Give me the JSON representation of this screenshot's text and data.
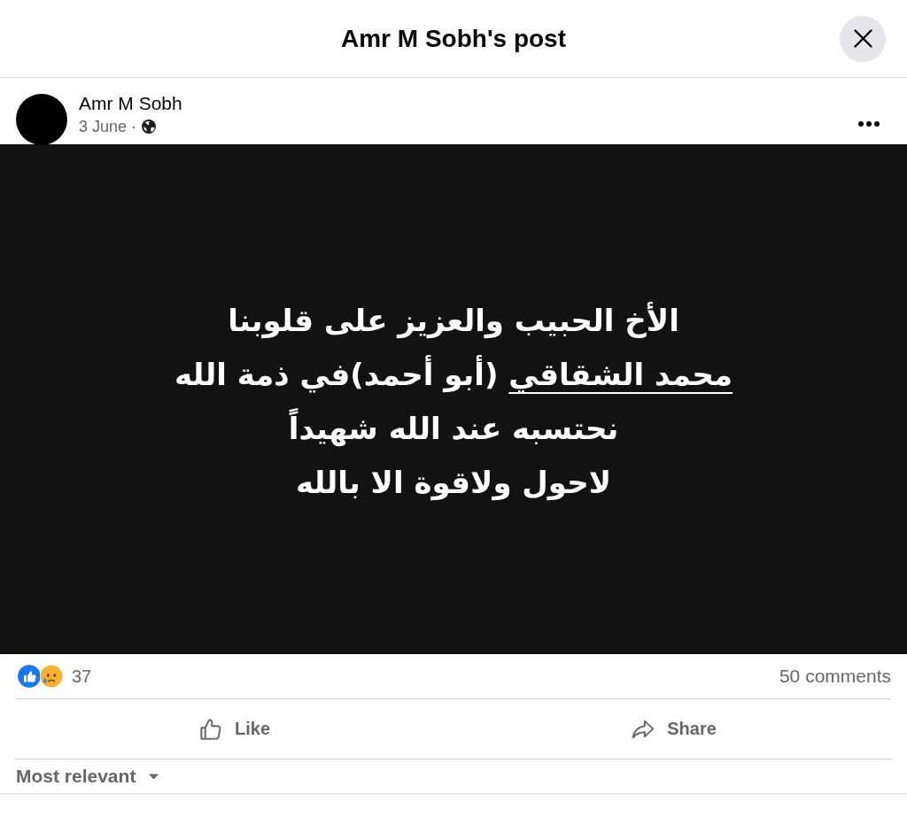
{
  "dialog": {
    "title": "Amr M Sobh's post"
  },
  "post": {
    "author": "Amr M Sobh",
    "date": "3 June ·",
    "text_lines": [
      {
        "segments": [
          {
            "kind": "plain",
            "text": "الأخ الحبيب والعزيز على قلوبنا"
          }
        ]
      },
      {
        "segments": [
          {
            "kind": "mention",
            "text": "محمد الشقاقي"
          },
          {
            "kind": "plain",
            "text": " (أبو أحمد)في ذمة الله"
          }
        ]
      },
      {
        "segments": [
          {
            "kind": "plain",
            "text": "نحتسبه عند الله شهيداً"
          }
        ]
      },
      {
        "segments": [
          {
            "kind": "plain",
            "text": "لاحول ولاقوة الا بالله"
          }
        ]
      }
    ]
  },
  "reactions": {
    "types": [
      {
        "kind": "like"
      },
      {
        "kind": "sad"
      }
    ],
    "count": "37",
    "comments": "50 comments"
  },
  "actions": {
    "like": {
      "label": "Like"
    },
    "share": {
      "label": "Share"
    }
  },
  "comments_filter": {
    "label": "Most relevant"
  }
}
